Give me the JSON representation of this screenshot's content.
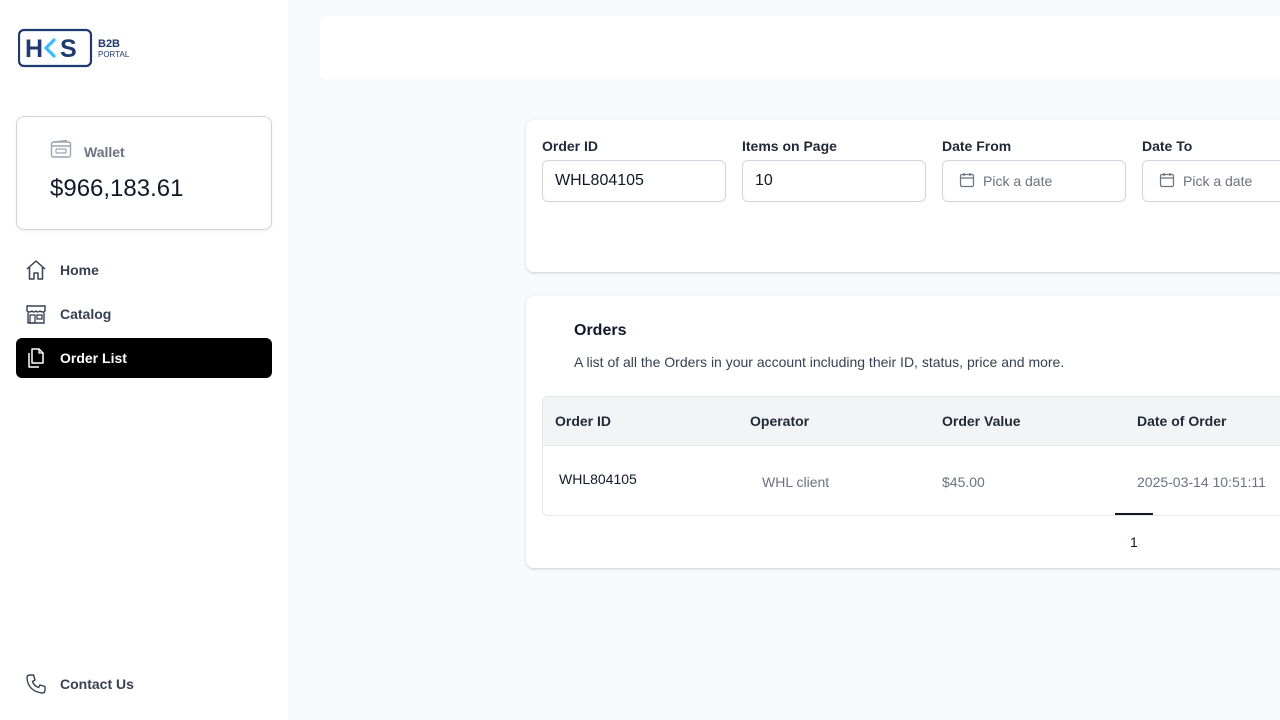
{
  "brand": {
    "logo_letters": "HKS",
    "logo_sub_top": "B2B",
    "logo_sub_bottom": "PORTAL"
  },
  "wallet": {
    "label": "Wallet",
    "amount": "$966,183.61",
    "icon": "wallet-icon"
  },
  "nav": {
    "items": [
      {
        "label": "Home",
        "icon": "home-icon",
        "active": false
      },
      {
        "label": "Catalog",
        "icon": "store-icon",
        "active": false
      },
      {
        "label": "Order List",
        "icon": "documents-icon",
        "active": true
      }
    ],
    "contact": {
      "label": "Contact Us",
      "icon": "phone-icon"
    }
  },
  "filters": {
    "order_id": {
      "label": "Order ID",
      "value": "WHL804105"
    },
    "items_on_page": {
      "label": "Items on Page",
      "value": "10"
    },
    "date_from": {
      "label": "Date From",
      "placeholder": "Pick a date"
    },
    "date_to": {
      "label": "Date To",
      "placeholder": "Pick a date"
    }
  },
  "orders": {
    "title": "Orders",
    "description": "A list of all the Orders in your account including their ID, status, price and more.",
    "columns": [
      "Order ID",
      "Operator",
      "Order Value",
      "Date of Order"
    ],
    "rows": [
      {
        "order_id": "WHL804105",
        "operator": "WHL client",
        "order_value": "$45.00",
        "date": "2025-03-14 10:51:11"
      }
    ],
    "pagination": {
      "current_page": "1"
    }
  },
  "colors": {
    "brand_navy": "#1e3a6e",
    "brand_cyan": "#38bdf8",
    "active_nav_bg": "#000000",
    "page_bg": "#f8f9fb"
  }
}
